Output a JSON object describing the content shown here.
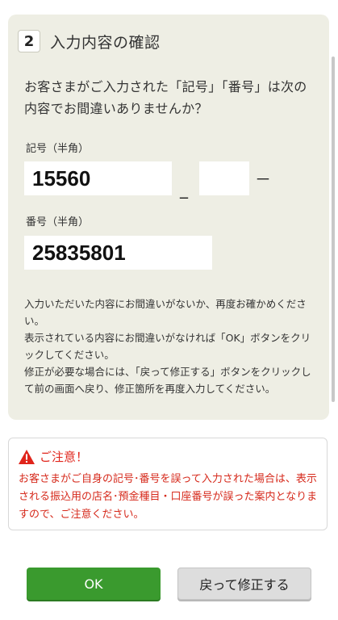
{
  "step": {
    "number": "2",
    "title": "入力内容の確認"
  },
  "question": "お客さまがご入力された「記号」「番号」は次の内容でお間違いありませんか？",
  "kigou": {
    "label": "記号（半角）",
    "value1": "15560",
    "separator1": "_",
    "value2": "",
    "separator2": "－"
  },
  "bangou": {
    "label": "番号（半角）",
    "value": "25835801"
  },
  "instructions": [
    "入力いただいた内容にお間違いがないか、再度お確かめください。",
    "表示されている内容にお間違いがなければ「OK」ボタンをクリックしてください。",
    "修正が必要な場合には、「戻って修正する」ボタンをクリックして前の画面へ戻り、修正箇所を再度入力してください。"
  ],
  "notice": {
    "title": "ご注意！",
    "body": "お客さまがご自身の記号･番号を誤って入力された場合は、表示される振込用の店名･預金種目・口座番号が誤った案内となりますので、ご注意ください。",
    "color": "#e0241b"
  },
  "buttons": {
    "ok": "OK",
    "back": "戻って修正する",
    "ok_color": "#3a9a2e"
  }
}
